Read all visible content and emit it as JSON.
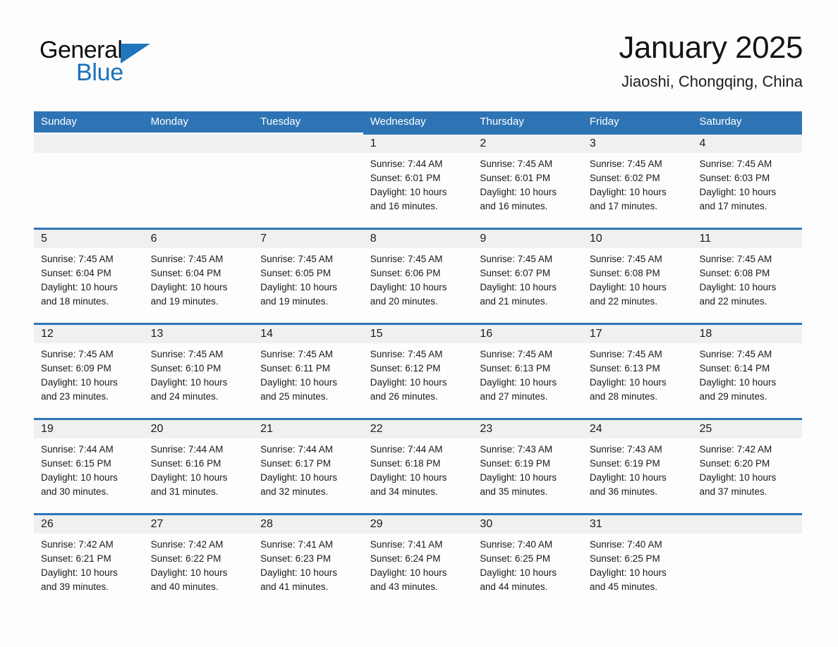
{
  "brand": {
    "name_part1": "General",
    "name_part2": "Blue",
    "triangle_color": "#1f76bc",
    "blue_color": "#1a72bb"
  },
  "header": {
    "month_title": "January 2025",
    "location": "Jiaoshi, Chongqing, China"
  },
  "theme": {
    "header_blue": "#2e74b5",
    "day_band_gray": "#f0f0f0",
    "text_color": "#1a1a1a"
  },
  "weekday_headers": [
    "Sunday",
    "Monday",
    "Tuesday",
    "Wednesday",
    "Thursday",
    "Friday",
    "Saturday"
  ],
  "weeks": [
    [
      {
        "blank": true
      },
      {
        "blank": true
      },
      {
        "blank": true
      },
      {
        "day": "1",
        "sunrise": "Sunrise: 7:44 AM",
        "sunset": "Sunset: 6:01 PM",
        "daylight_line1": "Daylight: 10 hours",
        "daylight_line2": "and 16 minutes."
      },
      {
        "day": "2",
        "sunrise": "Sunrise: 7:45 AM",
        "sunset": "Sunset: 6:01 PM",
        "daylight_line1": "Daylight: 10 hours",
        "daylight_line2": "and 16 minutes."
      },
      {
        "day": "3",
        "sunrise": "Sunrise: 7:45 AM",
        "sunset": "Sunset: 6:02 PM",
        "daylight_line1": "Daylight: 10 hours",
        "daylight_line2": "and 17 minutes."
      },
      {
        "day": "4",
        "sunrise": "Sunrise: 7:45 AM",
        "sunset": "Sunset: 6:03 PM",
        "daylight_line1": "Daylight: 10 hours",
        "daylight_line2": "and 17 minutes."
      }
    ],
    [
      {
        "day": "5",
        "sunrise": "Sunrise: 7:45 AM",
        "sunset": "Sunset: 6:04 PM",
        "daylight_line1": "Daylight: 10 hours",
        "daylight_line2": "and 18 minutes."
      },
      {
        "day": "6",
        "sunrise": "Sunrise: 7:45 AM",
        "sunset": "Sunset: 6:04 PM",
        "daylight_line1": "Daylight: 10 hours",
        "daylight_line2": "and 19 minutes."
      },
      {
        "day": "7",
        "sunrise": "Sunrise: 7:45 AM",
        "sunset": "Sunset: 6:05 PM",
        "daylight_line1": "Daylight: 10 hours",
        "daylight_line2": "and 19 minutes."
      },
      {
        "day": "8",
        "sunrise": "Sunrise: 7:45 AM",
        "sunset": "Sunset: 6:06 PM",
        "daylight_line1": "Daylight: 10 hours",
        "daylight_line2": "and 20 minutes."
      },
      {
        "day": "9",
        "sunrise": "Sunrise: 7:45 AM",
        "sunset": "Sunset: 6:07 PM",
        "daylight_line1": "Daylight: 10 hours",
        "daylight_line2": "and 21 minutes."
      },
      {
        "day": "10",
        "sunrise": "Sunrise: 7:45 AM",
        "sunset": "Sunset: 6:08 PM",
        "daylight_line1": "Daylight: 10 hours",
        "daylight_line2": "and 22 minutes."
      },
      {
        "day": "11",
        "sunrise": "Sunrise: 7:45 AM",
        "sunset": "Sunset: 6:08 PM",
        "daylight_line1": "Daylight: 10 hours",
        "daylight_line2": "and 22 minutes."
      }
    ],
    [
      {
        "day": "12",
        "sunrise": "Sunrise: 7:45 AM",
        "sunset": "Sunset: 6:09 PM",
        "daylight_line1": "Daylight: 10 hours",
        "daylight_line2": "and 23 minutes."
      },
      {
        "day": "13",
        "sunrise": "Sunrise: 7:45 AM",
        "sunset": "Sunset: 6:10 PM",
        "daylight_line1": "Daylight: 10 hours",
        "daylight_line2": "and 24 minutes."
      },
      {
        "day": "14",
        "sunrise": "Sunrise: 7:45 AM",
        "sunset": "Sunset: 6:11 PM",
        "daylight_line1": "Daylight: 10 hours",
        "daylight_line2": "and 25 minutes."
      },
      {
        "day": "15",
        "sunrise": "Sunrise: 7:45 AM",
        "sunset": "Sunset: 6:12 PM",
        "daylight_line1": "Daylight: 10 hours",
        "daylight_line2": "and 26 minutes."
      },
      {
        "day": "16",
        "sunrise": "Sunrise: 7:45 AM",
        "sunset": "Sunset: 6:13 PM",
        "daylight_line1": "Daylight: 10 hours",
        "daylight_line2": "and 27 minutes."
      },
      {
        "day": "17",
        "sunrise": "Sunrise: 7:45 AM",
        "sunset": "Sunset: 6:13 PM",
        "daylight_line1": "Daylight: 10 hours",
        "daylight_line2": "and 28 minutes."
      },
      {
        "day": "18",
        "sunrise": "Sunrise: 7:45 AM",
        "sunset": "Sunset: 6:14 PM",
        "daylight_line1": "Daylight: 10 hours",
        "daylight_line2": "and 29 minutes."
      }
    ],
    [
      {
        "day": "19",
        "sunrise": "Sunrise: 7:44 AM",
        "sunset": "Sunset: 6:15 PM",
        "daylight_line1": "Daylight: 10 hours",
        "daylight_line2": "and 30 minutes."
      },
      {
        "day": "20",
        "sunrise": "Sunrise: 7:44 AM",
        "sunset": "Sunset: 6:16 PM",
        "daylight_line1": "Daylight: 10 hours",
        "daylight_line2": "and 31 minutes."
      },
      {
        "day": "21",
        "sunrise": "Sunrise: 7:44 AM",
        "sunset": "Sunset: 6:17 PM",
        "daylight_line1": "Daylight: 10 hours",
        "daylight_line2": "and 32 minutes."
      },
      {
        "day": "22",
        "sunrise": "Sunrise: 7:44 AM",
        "sunset": "Sunset: 6:18 PM",
        "daylight_line1": "Daylight: 10 hours",
        "daylight_line2": "and 34 minutes."
      },
      {
        "day": "23",
        "sunrise": "Sunrise: 7:43 AM",
        "sunset": "Sunset: 6:19 PM",
        "daylight_line1": "Daylight: 10 hours",
        "daylight_line2": "and 35 minutes."
      },
      {
        "day": "24",
        "sunrise": "Sunrise: 7:43 AM",
        "sunset": "Sunset: 6:19 PM",
        "daylight_line1": "Daylight: 10 hours",
        "daylight_line2": "and 36 minutes."
      },
      {
        "day": "25",
        "sunrise": "Sunrise: 7:42 AM",
        "sunset": "Sunset: 6:20 PM",
        "daylight_line1": "Daylight: 10 hours",
        "daylight_line2": "and 37 minutes."
      }
    ],
    [
      {
        "day": "26",
        "sunrise": "Sunrise: 7:42 AM",
        "sunset": "Sunset: 6:21 PM",
        "daylight_line1": "Daylight: 10 hours",
        "daylight_line2": "and 39 minutes."
      },
      {
        "day": "27",
        "sunrise": "Sunrise: 7:42 AM",
        "sunset": "Sunset: 6:22 PM",
        "daylight_line1": "Daylight: 10 hours",
        "daylight_line2": "and 40 minutes."
      },
      {
        "day": "28",
        "sunrise": "Sunrise: 7:41 AM",
        "sunset": "Sunset: 6:23 PM",
        "daylight_line1": "Daylight: 10 hours",
        "daylight_line2": "and 41 minutes."
      },
      {
        "day": "29",
        "sunrise": "Sunrise: 7:41 AM",
        "sunset": "Sunset: 6:24 PM",
        "daylight_line1": "Daylight: 10 hours",
        "daylight_line2": "and 43 minutes."
      },
      {
        "day": "30",
        "sunrise": "Sunrise: 7:40 AM",
        "sunset": "Sunset: 6:25 PM",
        "daylight_line1": "Daylight: 10 hours",
        "daylight_line2": "and 44 minutes."
      },
      {
        "day": "31",
        "sunrise": "Sunrise: 7:40 AM",
        "sunset": "Sunset: 6:25 PM",
        "daylight_line1": "Daylight: 10 hours",
        "daylight_line2": "and 45 minutes."
      },
      {
        "blank": true
      }
    ]
  ]
}
